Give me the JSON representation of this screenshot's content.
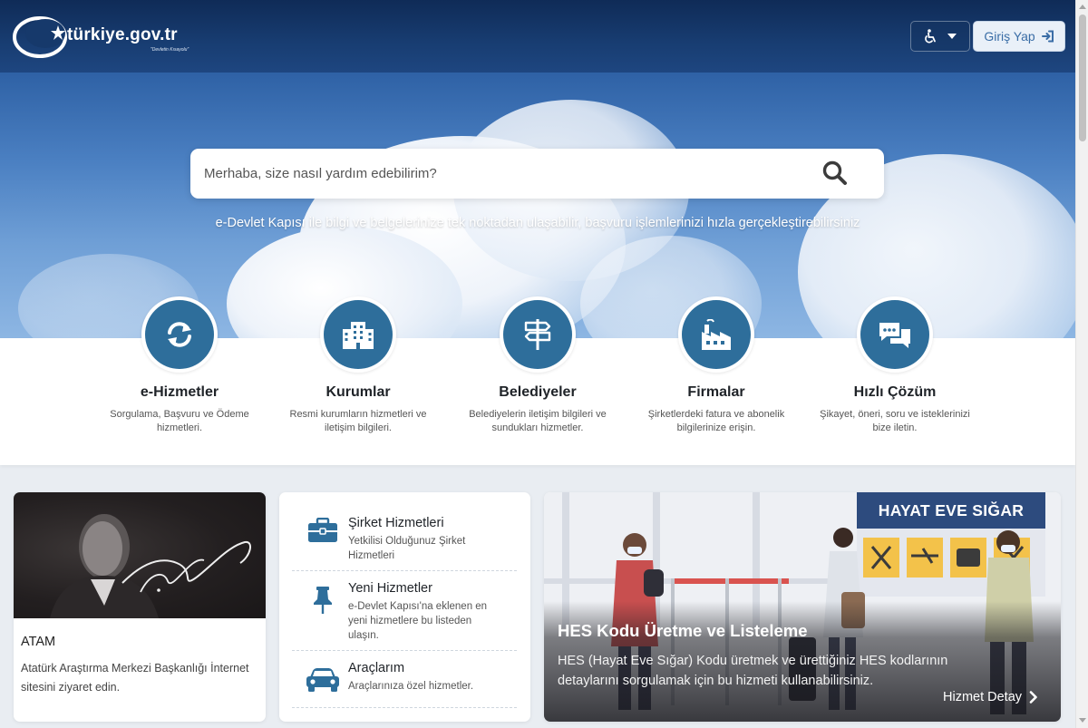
{
  "header": {
    "logo_text": "türkiye.gov.tr",
    "logo_sub": "\"Devletin Kısayolu\"",
    "accessibility_icon": "wheelchair-icon",
    "login_label": "Giriş Yap",
    "login_icon": "sign-in-icon"
  },
  "search": {
    "placeholder": "Merhaba, size nasıl yardım edebilirim?",
    "icon": "search-icon"
  },
  "tagline": "e-Devlet Kapısı ile bilgi ve belgelerinize tek noktadan ulaşabilir, başvuru işlemlerinizi hızla gerçekleştirebilirsiniz",
  "categories": [
    {
      "title": "e-Hizmetler",
      "desc": "Sorgulama, Başvuru ve Ödeme hizmetleri.",
      "icon": "refresh-icon"
    },
    {
      "title": "Kurumlar",
      "desc": "Resmi kurumların hizmetleri ve iletişim bilgileri.",
      "icon": "building-icon"
    },
    {
      "title": "Belediyeler",
      "desc": "Belediyelerin iletişim bilgileri ve sundukları hizmetler.",
      "icon": "signpost-icon"
    },
    {
      "title": "Firmalar",
      "desc": "Şirketlerdeki fatura ve abonelik bilgilerinize erişin.",
      "icon": "factory-icon"
    },
    {
      "title": "Hızlı Çözüm",
      "desc": "Şikayet, öneri, soru ve isteklerinizi bize iletin.",
      "icon": "chat-icon"
    }
  ],
  "atam": {
    "title": "ATAM",
    "desc": "Atatürk Araştırma Merkezi Başkanlığı İnternet sitesini ziyaret edin."
  },
  "services": [
    {
      "title": "Şirket Hizmetleri",
      "desc": "Yetkilisi Olduğunuz Şirket Hizmetleri",
      "icon": "briefcase-icon"
    },
    {
      "title": "Yeni Hizmetler",
      "desc": "e-Devlet Kapısı'na eklenen en yeni hizmetlere bu listeden ulaşın.",
      "icon": "pin-icon"
    },
    {
      "title": "Araçlarım",
      "desc": "Araçlarınıza özel hizmetler.",
      "icon": "car-icon"
    }
  ],
  "hes": {
    "badge": "HAYAT EVE SIĞAR",
    "title": "HES Kodu Üretme ve Listeleme",
    "desc": "HES (Hayat Eve Sığar) Kodu üretmek ve ürettiğiniz HES kodlarının detaylarını sorgulamak için bu hizmeti kullanabilirsiniz.",
    "link": "Hizmet Detay"
  }
}
